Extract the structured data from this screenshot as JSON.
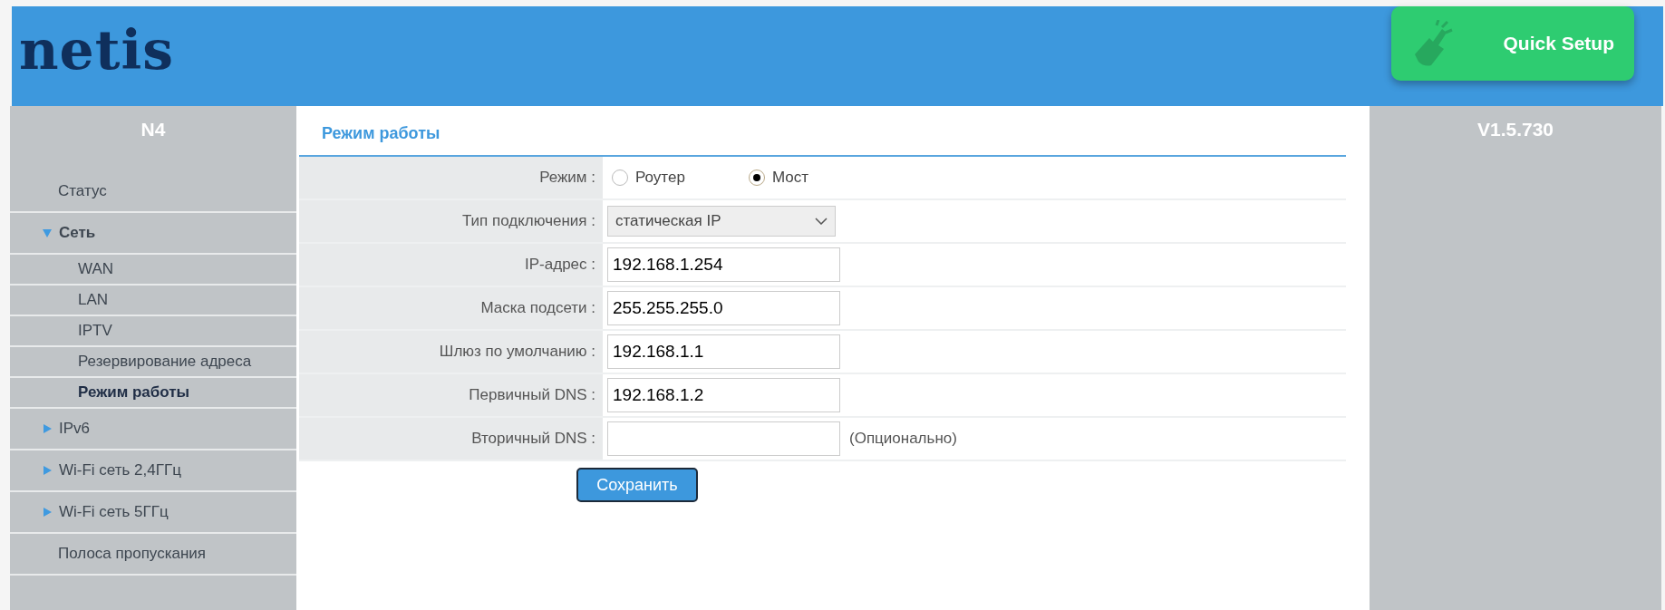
{
  "header": {
    "logo": "netis",
    "quick_setup": "Quick Setup"
  },
  "sidebar": {
    "model": "N4",
    "items": [
      {
        "label": "Статус",
        "selected": false
      },
      {
        "label": "Сеть",
        "selected": false,
        "expanded": true,
        "children": [
          {
            "label": "WAN",
            "selected": false
          },
          {
            "label": "LAN",
            "selected": false
          },
          {
            "label": "IPTV",
            "selected": false
          },
          {
            "label": "Резервирование адреса",
            "selected": false
          },
          {
            "label": "Режим работы",
            "selected": true
          }
        ]
      },
      {
        "label": "IPv6",
        "selected": false,
        "expanded": false
      },
      {
        "label": "Wi-Fi сеть 2,4ГГц",
        "selected": false,
        "expanded": false
      },
      {
        "label": "Wi-Fi сеть 5ГГц",
        "selected": false,
        "expanded": false
      },
      {
        "label": "Полоса пропускания",
        "selected": false
      }
    ]
  },
  "content": {
    "title": "Режим работы",
    "fields": [
      {
        "kind": "radio",
        "label": "Режим :",
        "options": [
          {
            "label": "Роутер",
            "selected": false
          },
          {
            "label": "Мост",
            "selected": true
          }
        ]
      },
      {
        "kind": "select",
        "label": "Тип подключения :",
        "value": "статическая IP"
      },
      {
        "kind": "text",
        "label": "IP-адрес :",
        "value": "192.168.1.254"
      },
      {
        "kind": "text",
        "label": "Маска подсети :",
        "value": "255.255.255.0"
      },
      {
        "kind": "text",
        "label": "Шлюз по умолчанию :",
        "value": "192.168.1.1"
      },
      {
        "kind": "text",
        "label": "Первичный DNS :",
        "value": "192.168.1.2"
      },
      {
        "kind": "text",
        "label": "Вторичный DNS :",
        "note": "(Опционально)"
      }
    ],
    "save_button": "Сохранить"
  },
  "version": "V1.5.730"
}
